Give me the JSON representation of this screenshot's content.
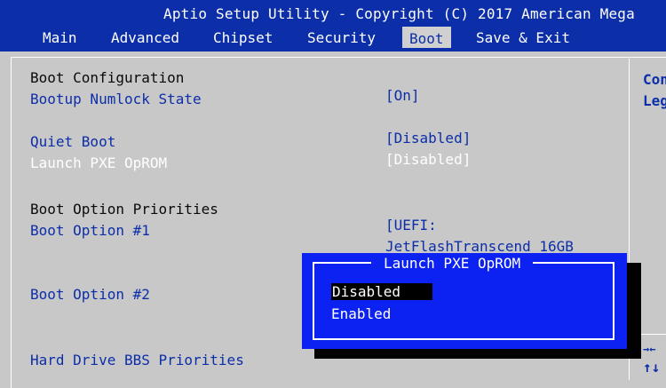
{
  "header": {
    "title": "Aptio Setup Utility - Copyright (C) 2017 American Mega",
    "tabs": [
      {
        "label": "Main"
      },
      {
        "label": "Advanced"
      },
      {
        "label": "Chipset"
      },
      {
        "label": "Security"
      },
      {
        "label": "Boot",
        "active": true
      },
      {
        "label": "Save & Exit"
      }
    ]
  },
  "settings": {
    "boot_config": "Boot Configuration",
    "numlock_label": "Bootup Numlock State",
    "numlock_value": "[On]",
    "quiet_label": "Quiet Boot",
    "quiet_value": "[Disabled]",
    "pxe_label": "Launch PXE OpROM",
    "pxe_value": "[Disabled]",
    "priorities": "Boot Option Priorities",
    "opt1_label": "Boot Option #1",
    "opt1_value_line1": "[UEFI:",
    "opt1_value_line2": "JetFlashTranscend 16GB",
    "opt2_label": "Boot Option #2",
    "hdd_label": "Hard Drive BBS Priorities"
  },
  "help": {
    "line1": "Con",
    "line2": "Leg",
    "arrows_lr": "→←",
    "arrows_ud": "↑↓"
  },
  "popup": {
    "title": "Launch PXE OpROM",
    "options": [
      {
        "label": "Disabled",
        "selected": true
      },
      {
        "label": "Enabled",
        "selected": false
      }
    ]
  },
  "colors": {
    "bios_blue": "#0c2ea8",
    "background_gray": "#c8c8c8",
    "popup_blue": "#0b22f2"
  }
}
